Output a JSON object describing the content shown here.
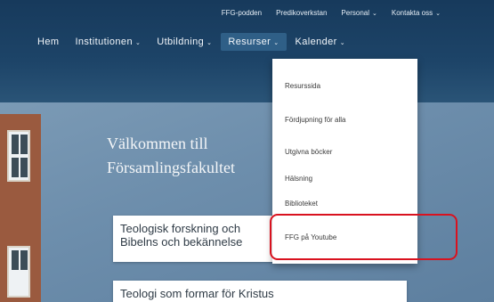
{
  "topbar": {
    "items": [
      {
        "label": "FFG-podden",
        "has_dropdown": false
      },
      {
        "label": "Predikoverkstan",
        "has_dropdown": false
      },
      {
        "label": "Personal",
        "has_dropdown": true
      },
      {
        "label": "Kontakta oss",
        "has_dropdown": true
      }
    ]
  },
  "mainnav": {
    "items": [
      {
        "label": "Hem",
        "has_dropdown": false
      },
      {
        "label": "Institutionen",
        "has_dropdown": true
      },
      {
        "label": "Utbildning",
        "has_dropdown": true
      },
      {
        "label": "Resurser",
        "has_dropdown": true,
        "active": true
      },
      {
        "label": "Kalender",
        "has_dropdown": true
      }
    ]
  },
  "dropdown": {
    "items": [
      {
        "label": "Resurssida"
      },
      {
        "label": "Fördjupning för alla"
      },
      {
        "label": "Utgivna böcker"
      },
      {
        "label": "Hälsning"
      },
      {
        "label": "Biblioteket"
      },
      {
        "label": "FFG på Youtube"
      }
    ]
  },
  "hero": {
    "welcome_line1": "Välkommen till",
    "welcome_line2": "Församlingsfakultet"
  },
  "cards": [
    {
      "line1": "Teologisk forskning och",
      "line2": "Bibelns och bekännelse"
    },
    {
      "line1": "Teologi som formar för Kristus"
    }
  ],
  "colors": {
    "header": "#1d4468",
    "hero": "#6d8eac",
    "highlight": "#d9121f",
    "dropdown_bg": "#ffffff"
  },
  "icons": {
    "dropdown_chevron": "chevron-down-icon"
  }
}
